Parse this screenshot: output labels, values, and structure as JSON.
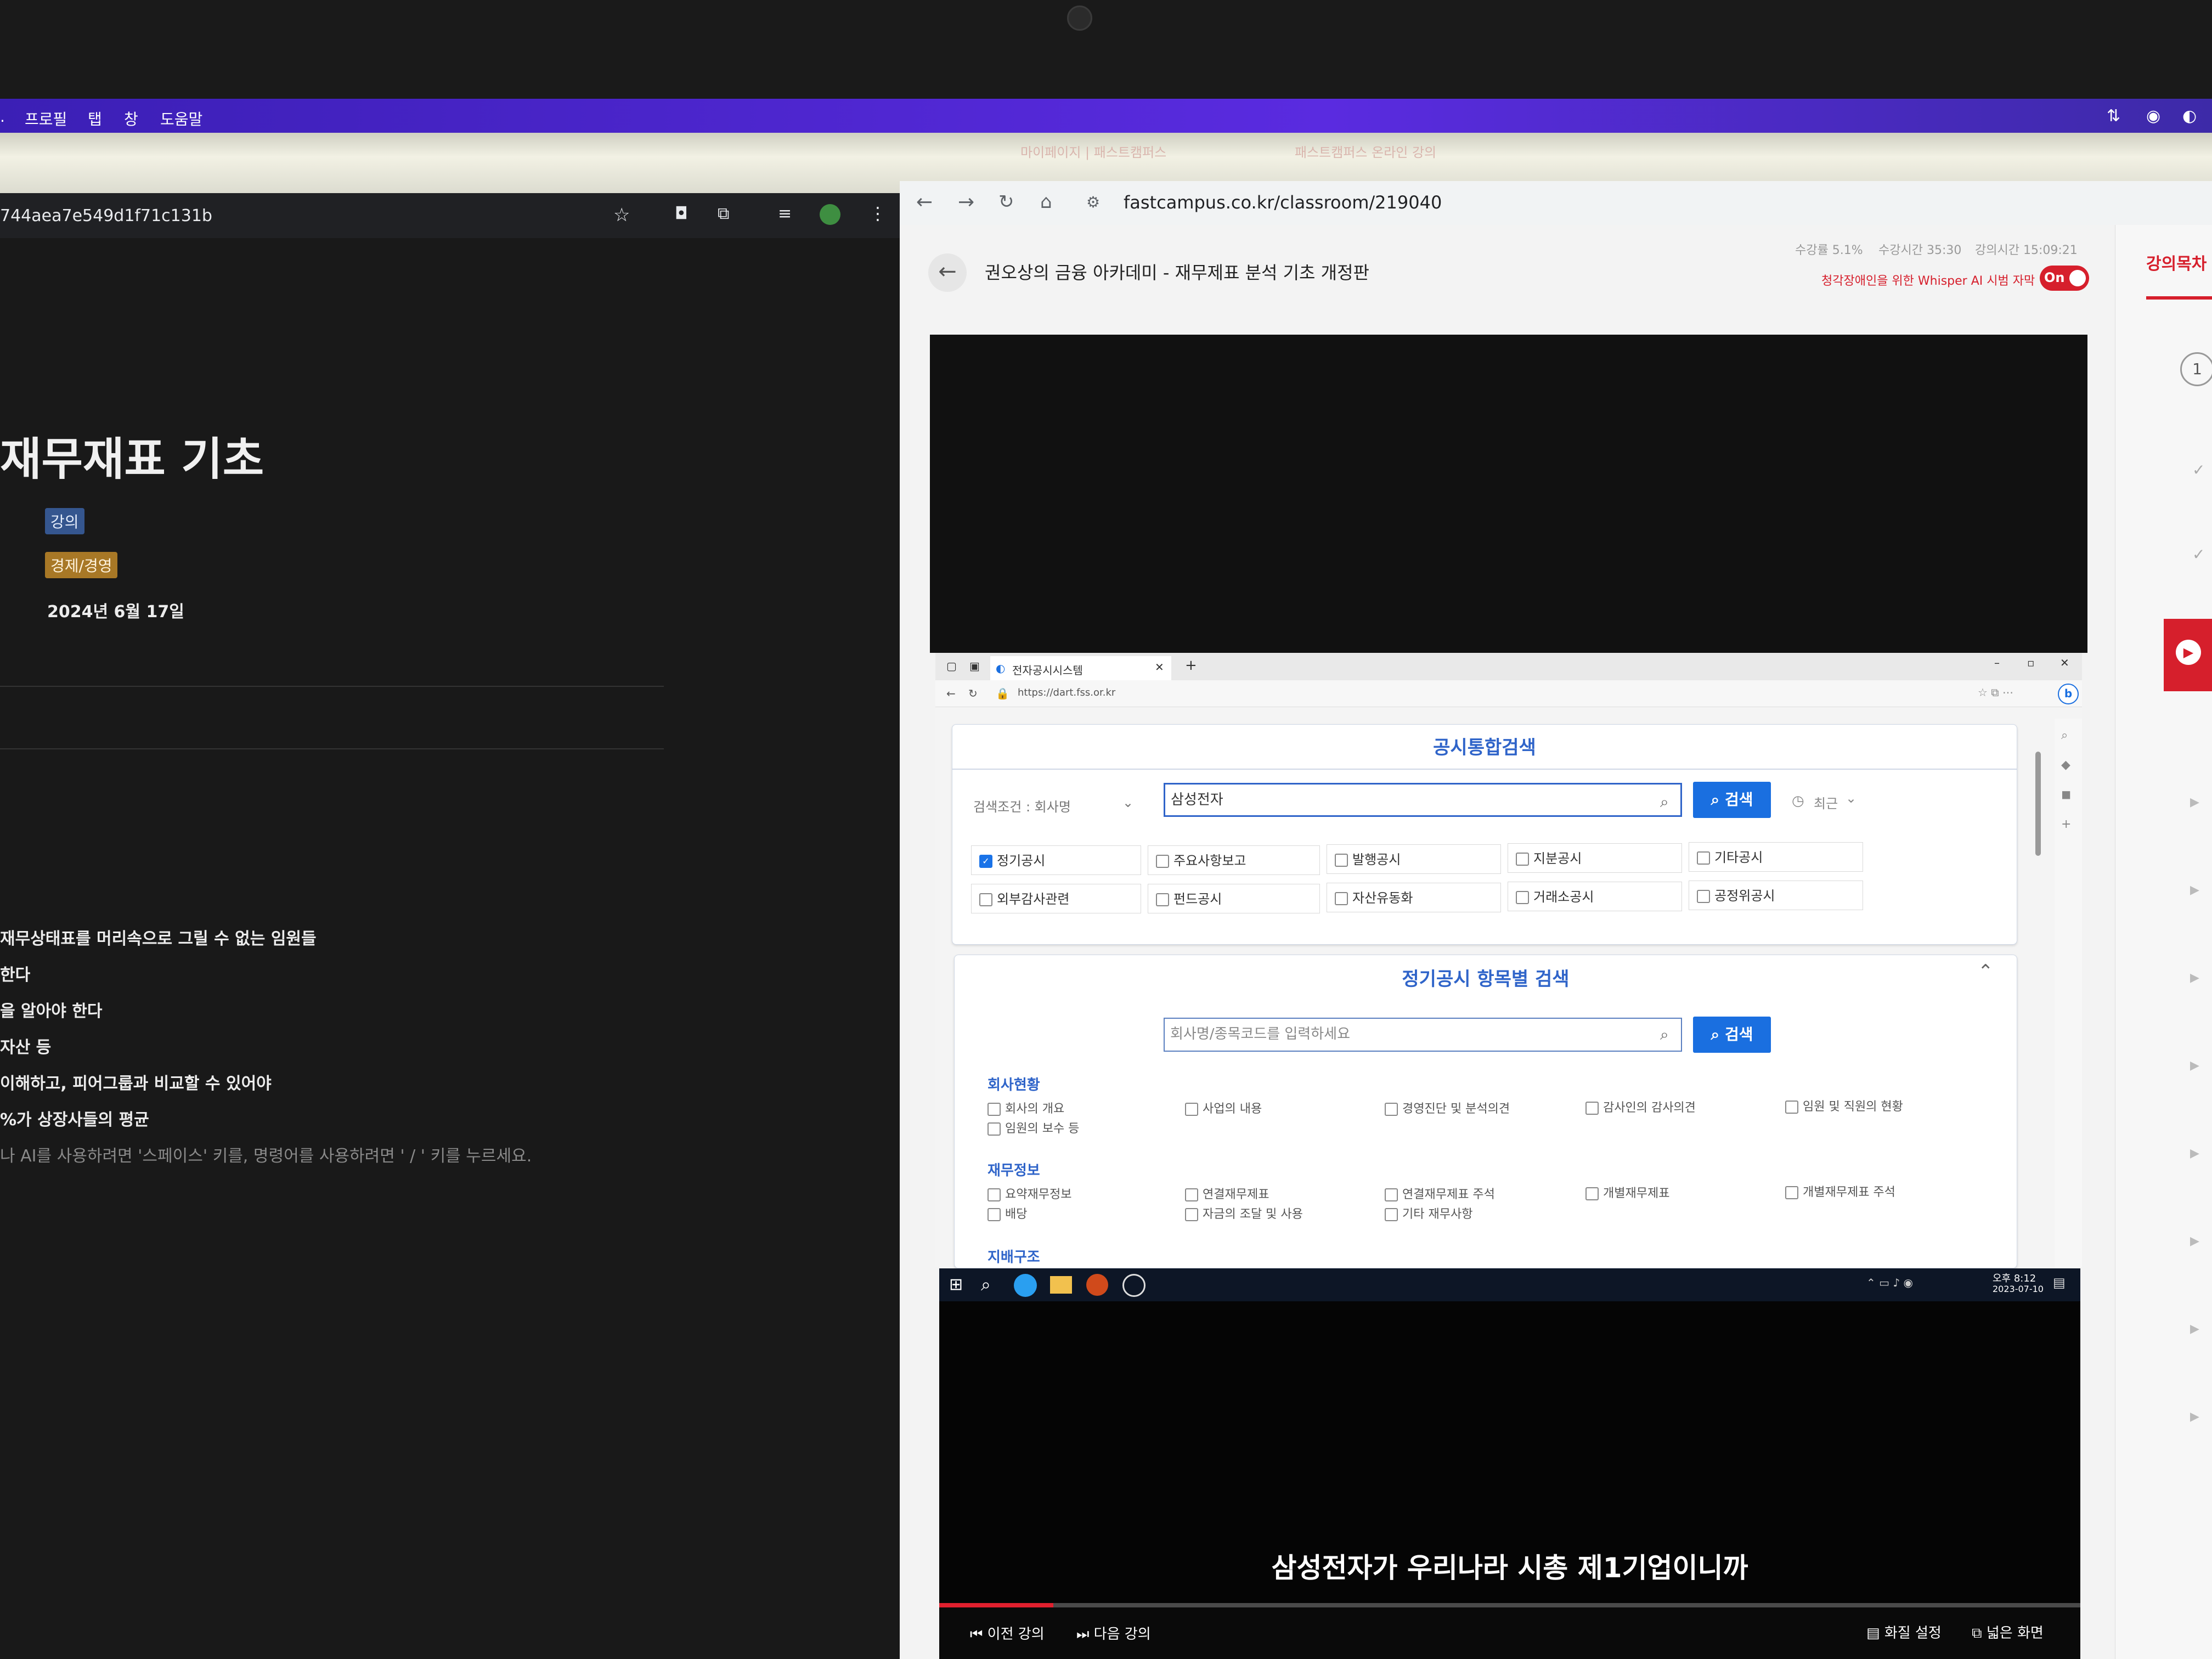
{
  "menubar": {
    "items": [
      "프로필",
      "탭",
      "창",
      "도움말"
    ]
  },
  "tabs": [
    {
      "title": "마이페이지 | 패스트캠퍼스"
    },
    {
      "title": "패스트캠퍼스 온라인 강의"
    }
  ],
  "left_window": {
    "url": "744aea7e549d1f71c131b",
    "page_title": "재무재표 기초",
    "tags": [
      {
        "label": "강의",
        "color": "#35568f"
      },
      {
        "label": "경제/경영",
        "color": "#a87826"
      }
    ],
    "date": "2024년 6월 17일",
    "lines": [
      "재무상태표를 머리속으로 그릴 수 없는 임원들",
      "한다",
      "을 알아야 한다",
      "자산 등",
      "이해하고, 피어그룹과 비교할 수 있어야",
      "%가 상장사들의 평균"
    ],
    "hint": "나 AI를 사용하려면 '스페이스' 키를, 명령어를 사용하려면 ' / ' 키를 누르세요."
  },
  "right_window": {
    "url": "fastcampus.co.kr/classroom/219040",
    "course_title": "권오상의 금융 아카데미 - 재무제표 분석 기초 개정판",
    "stats": {
      "progress": "수강률 5.1%",
      "watch_time": "수강시간 35:30",
      "lecture_time": "강의시간 15:09:21"
    },
    "whisper_label": "청각장애인을 위한 Whisper AI 시범 자막",
    "whisper_toggle": "On",
    "sidebar_title": "강의목차",
    "sidebar_number": "1"
  },
  "video_screen": {
    "tab_title": "전자공시시스템",
    "address": "https://dart.fss.or.kr",
    "search_panel": {
      "title": "공시통합검색",
      "condition": "검색조건 : 회사명",
      "query": "삼성전자",
      "search_button": "검색",
      "recent_label": "최근",
      "checkboxes_row1": [
        "정기공시",
        "주요사항보고",
        "발행공시",
        "지분공시",
        "기타공시"
      ],
      "checkboxes_row2": [
        "외부감사관련",
        "펀드공시",
        "자산유동화",
        "거래소공시",
        "공정위공시"
      ]
    },
    "item_panel": {
      "title": "정기공시 항목별 검색",
      "placeholder": "회사명/종목코드를 입력하세요",
      "search_button": "검색",
      "sections": [
        {
          "name": "회사현황",
          "items": [
            "회사의 개요",
            "사업의 내용",
            "경영진단 및 분석의견",
            "감사인의 감사의견",
            "임원 및 직원의 현황",
            "임원의 보수 등"
          ]
        },
        {
          "name": "재무정보",
          "items": [
            "요약재무정보",
            "연결재무제표",
            "연결재무제표 주석",
            "개별재무제표",
            "개별재무제표 주석",
            "배당",
            "자금의 조달 및 사용",
            "기타 재무사항"
          ]
        },
        {
          "name": "지배구조",
          "items": []
        }
      ]
    },
    "taskbar_time": "오후 8:12",
    "taskbar_date": "2023-07-10"
  },
  "player": {
    "subtitle": "삼성전자가 우리나라 시총 제1기업이니까",
    "progress": 0.1,
    "prev_label": "이전 강의",
    "next_label": "다음 강의",
    "quality_label": "화질 설정",
    "wide_label": "넓은 화면"
  }
}
